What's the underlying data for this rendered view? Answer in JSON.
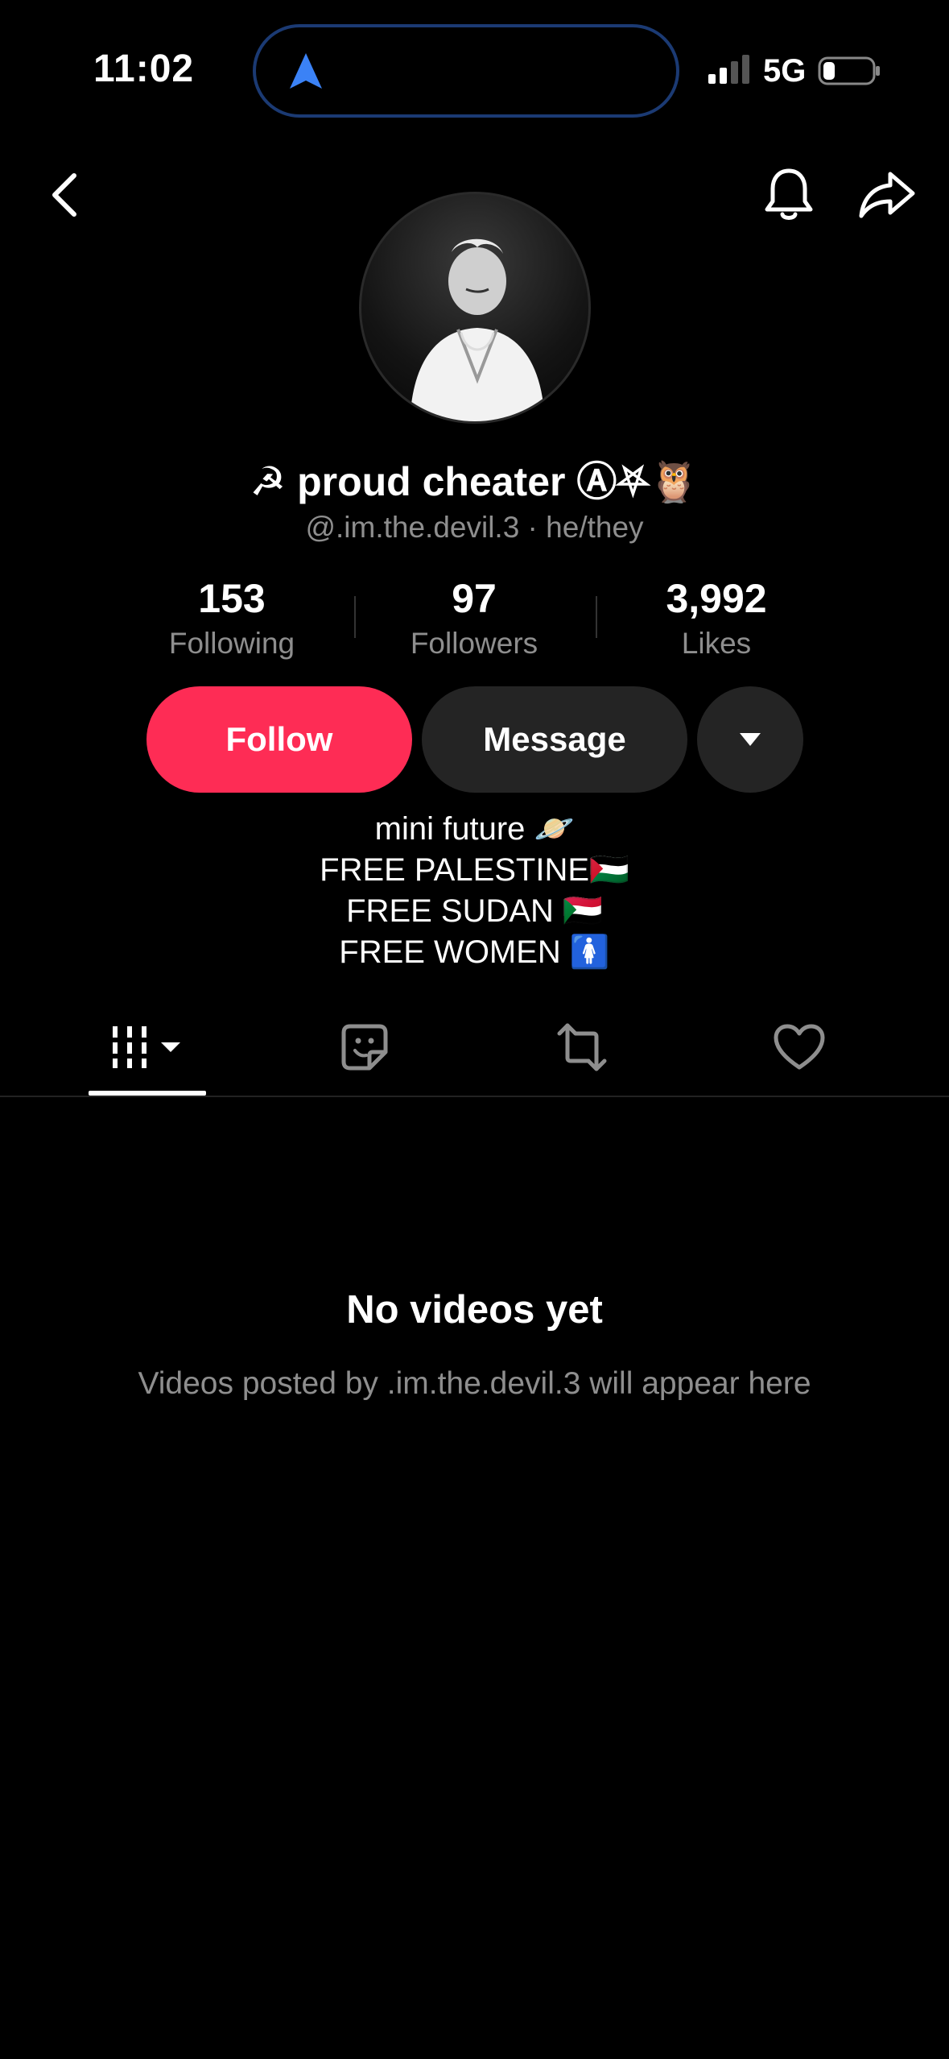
{
  "status_bar": {
    "time": "11:02",
    "network": "5G",
    "icons": [
      "navigation-arrow-icon",
      "signal-bars-icon",
      "battery-icon"
    ]
  },
  "header": {
    "icons": [
      "back-icon",
      "bell-icon",
      "share-icon"
    ]
  },
  "profile": {
    "display_name": "☭ proud cheater Ⓐ⛧🦉",
    "username_line": "@.im.the.devil.3 · he/they",
    "stats": [
      {
        "value": "153",
        "label": "Following"
      },
      {
        "value": "97",
        "label": "Followers"
      },
      {
        "value": "3,992",
        "label": "Likes"
      }
    ],
    "bio": [
      "mini future 🪐",
      "FREE PALESTINE🇵🇸",
      "FREE SUDAN 🇸🇩",
      "FREE WOMEN 🚺"
    ]
  },
  "actions": {
    "follow_label": "Follow",
    "message_label": "Message",
    "more_icon": "caret-down-icon"
  },
  "tabs": {
    "items": [
      "videos-grid-icon",
      "stickers-icon",
      "repost-icon",
      "heart-icon"
    ],
    "active_index": 0
  },
  "empty_state": {
    "title": "No videos yet",
    "subtitle": "Videos posted by .im.the.devil.3 will appear here"
  },
  "colors": {
    "background": "#000000",
    "accent": "#fe2c55",
    "secondary_button": "#242424",
    "muted_text": "#8e8e8e",
    "island_border": "#1b3a73",
    "nav_arrow": "#3b82f6"
  }
}
